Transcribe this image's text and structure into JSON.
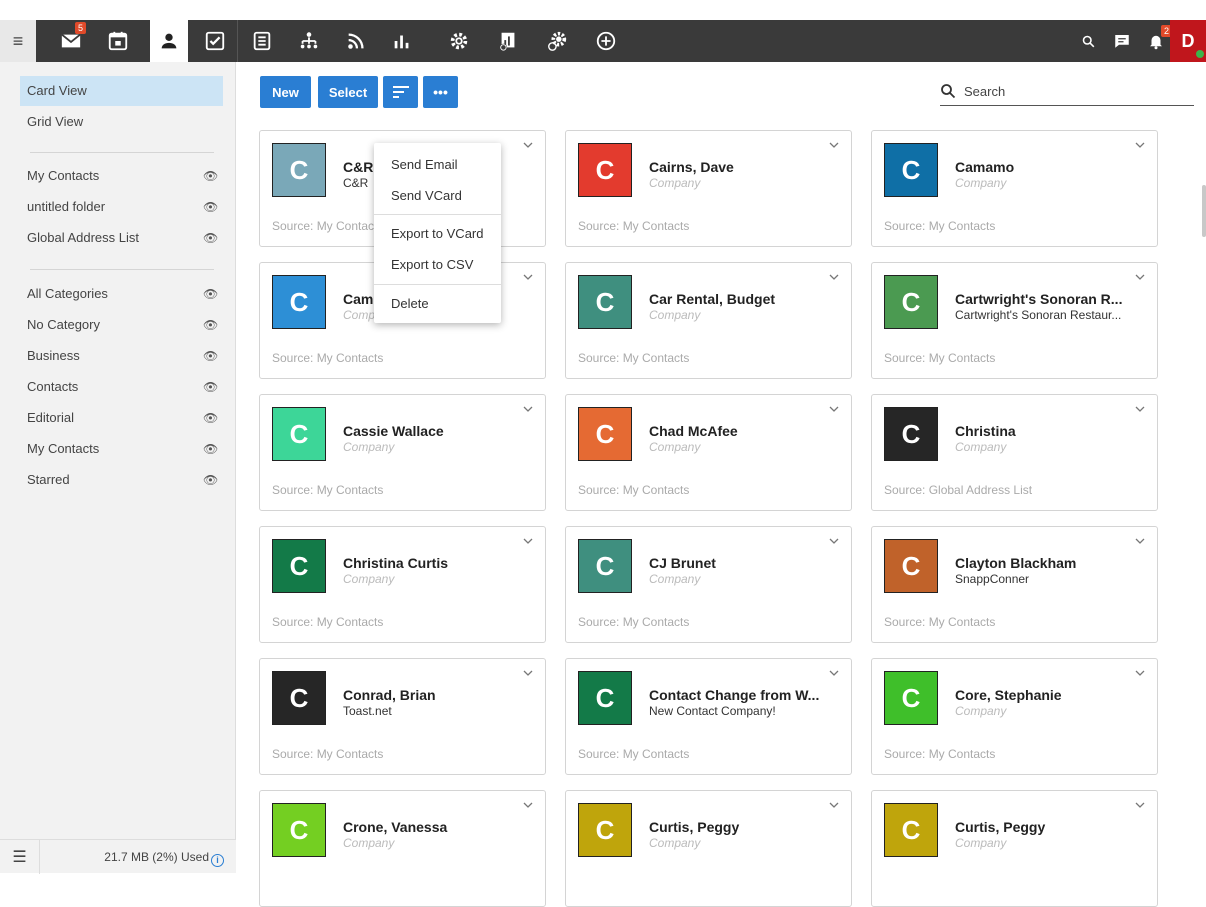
{
  "topbar": {
    "mail_badge": "5",
    "notifications_badge": "2",
    "avatar_letter": "D"
  },
  "sidebar": {
    "views": [
      {
        "label": "Card View",
        "active": true
      },
      {
        "label": "Grid View",
        "active": false
      }
    ],
    "folders": [
      {
        "label": "My Contacts"
      },
      {
        "label": "untitled folder"
      },
      {
        "label": "Global Address List"
      }
    ],
    "categories": [
      {
        "label": "All Categories"
      },
      {
        "label": "No Category"
      },
      {
        "label": "Business"
      },
      {
        "label": "Contacts"
      },
      {
        "label": "Editorial"
      },
      {
        "label": "My Contacts"
      },
      {
        "label": "Starred"
      }
    ],
    "usage": "21.7 MB (2%) Used"
  },
  "actions": {
    "new_label": "New",
    "select_label": "Select",
    "search_placeholder": "Search"
  },
  "context_menu": {
    "items": [
      "Send Email",
      "Send VCard",
      "Export to VCard",
      "Export to CSV",
      "Delete"
    ]
  },
  "cards": [
    {
      "letter": "C",
      "name": "C&R",
      "company": "C&R",
      "placeholder": false,
      "source": "Source: My Contacts",
      "color": "#7aa8b8"
    },
    {
      "letter": "C",
      "name": "Cairns, Dave",
      "company": "Company",
      "placeholder": true,
      "source": "Source: My Contacts",
      "color": "#e33b2e"
    },
    {
      "letter": "C",
      "name": "Camamo",
      "company": "Company",
      "placeholder": true,
      "source": "Source: My Contacts",
      "color": "#0f6fa6"
    },
    {
      "letter": "C",
      "name": "Cam",
      "company": "Company",
      "placeholder": true,
      "source": "Source: My Contacts",
      "color": "#2d8fd6"
    },
    {
      "letter": "C",
      "name": "Car Rental, Budget",
      "company": "Company",
      "placeholder": true,
      "source": "Source: My Contacts",
      "color": "#3f8f7f"
    },
    {
      "letter": "C",
      "name": "Cartwright's Sonoran R...",
      "company": "Cartwright's Sonoran Restaur...",
      "placeholder": false,
      "source": "Source: My Contacts",
      "color": "#4b9a51"
    },
    {
      "letter": "C",
      "name": "Cassie Wallace",
      "company": "Company",
      "placeholder": true,
      "source": "Source: My Contacts",
      "color": "#3dd698"
    },
    {
      "letter": "C",
      "name": "Chad McAfee",
      "company": "Company",
      "placeholder": true,
      "source": "Source: My Contacts",
      "color": "#e56a33"
    },
    {
      "letter": "C",
      "name": "Christina",
      "company": "Company",
      "placeholder": true,
      "source": "Source: Global Address List",
      "color": "#262626"
    },
    {
      "letter": "C",
      "name": "Christina Curtis",
      "company": "Company",
      "placeholder": true,
      "source": "Source: My Contacts",
      "color": "#137a48"
    },
    {
      "letter": "C",
      "name": "CJ Brunet",
      "company": "Company",
      "placeholder": true,
      "source": "Source: My Contacts",
      "color": "#3f8f7f"
    },
    {
      "letter": "C",
      "name": "Clayton Blackham",
      "company": "SnappConner",
      "placeholder": false,
      "source": "Source: My Contacts",
      "color": "#c0622a"
    },
    {
      "letter": "C",
      "name": "Conrad, Brian",
      "company": "Toast.net",
      "placeholder": false,
      "source": "Source: My Contacts",
      "color": "#262626"
    },
    {
      "letter": "C",
      "name": "Contact Change from W...",
      "company": "New Contact Company!",
      "placeholder": false,
      "source": "Source: My Contacts",
      "color": "#137a48"
    },
    {
      "letter": "C",
      "name": "Core, Stephanie",
      "company": "Company",
      "placeholder": true,
      "source": "Source: My Contacts",
      "color": "#3fbf2a"
    },
    {
      "letter": "C",
      "name": "Crone, Vanessa",
      "company": "Company",
      "placeholder": true,
      "source": "",
      "color": "#74cf22"
    },
    {
      "letter": "C",
      "name": "Curtis, Peggy",
      "company": "Company",
      "placeholder": true,
      "source": "",
      "color": "#bfa50c"
    },
    {
      "letter": "C",
      "name": "Curtis, Peggy",
      "company": "Company",
      "placeholder": true,
      "source": "",
      "color": "#bfa50c"
    }
  ]
}
